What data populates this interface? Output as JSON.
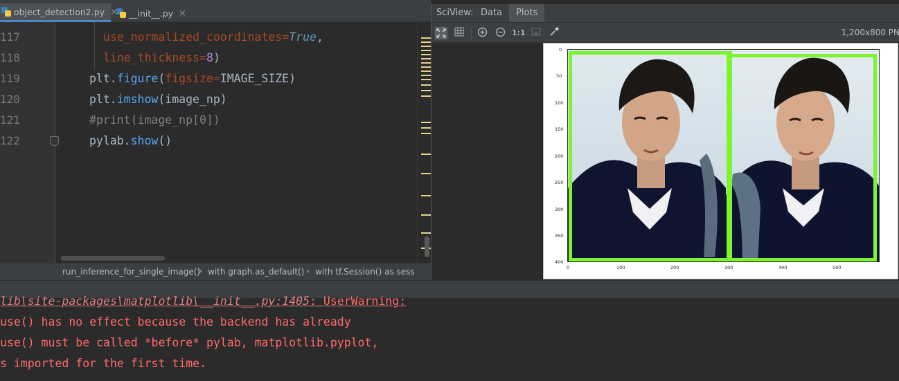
{
  "editor_tabs": [
    {
      "label": "object_detection2.py",
      "close": "×",
      "active": true
    },
    {
      "label": "__init__.py",
      "close": "×",
      "active": false
    }
  ],
  "gutter_lines": [
    "117",
    "118",
    "119",
    "120",
    "121",
    "122"
  ],
  "code": {
    "l117": {
      "param": "use_normalized_coordinates",
      "eq": "=",
      "value": "True",
      "tail": ","
    },
    "l118": {
      "param": "line_thickness",
      "eq": "=",
      "value": "8",
      "tail": ")"
    },
    "l119": {
      "obj": "plt.",
      "fn": "figure",
      "open": "(",
      "param": "figsize",
      "eq": "=",
      "arg": "IMAGE_SIZE)"
    },
    "l120": {
      "obj": "plt.",
      "fn": "imshow",
      "args": "(image_np)"
    },
    "l121": {
      "comment": "#print(image_np[0])"
    },
    "l122": {
      "obj": "pylab.",
      "fn": "show",
      "args": "()"
    }
  },
  "breadcrumb": {
    "items": [
      "run_inference_for_single_image()",
      "with graph.as_default()",
      "with tf.Session() as sess"
    ],
    "separator": "›"
  },
  "sciview": {
    "title": "SciView:",
    "tabs": [
      "Data",
      "Plots"
    ],
    "active_tab": "Plots",
    "toolbar_icons": [
      "fit-screen-icon",
      "grid-icon",
      "zoom-in-icon",
      "zoom-out-icon",
      "actual-size-icon",
      "background-icon",
      "color-picker-icon"
    ],
    "actual_size_label": "1:1",
    "image_info": "1,200x800 PN",
    "plot": {
      "y_ticks": [
        "0",
        "50",
        "100",
        "150",
        "200",
        "250",
        "300",
        "350",
        "400"
      ],
      "x_ticks": [
        "0",
        "100",
        "200",
        "300",
        "400",
        "500"
      ],
      "xlim": [
        0,
        580
      ],
      "ylim": [
        400,
        0
      ],
      "box_color": "#7cf530"
    }
  },
  "console": {
    "line1_path": "lib\\site-packages\\matplotlib\\__init__.py:1405",
    "line1_tail": ": UserWarning:",
    "line2": "use() has no effect because the backend has already",
    "line3": "use() must be called *before* pylab, matplotlib.pyplot,",
    "line4": "s imported for the first time."
  }
}
